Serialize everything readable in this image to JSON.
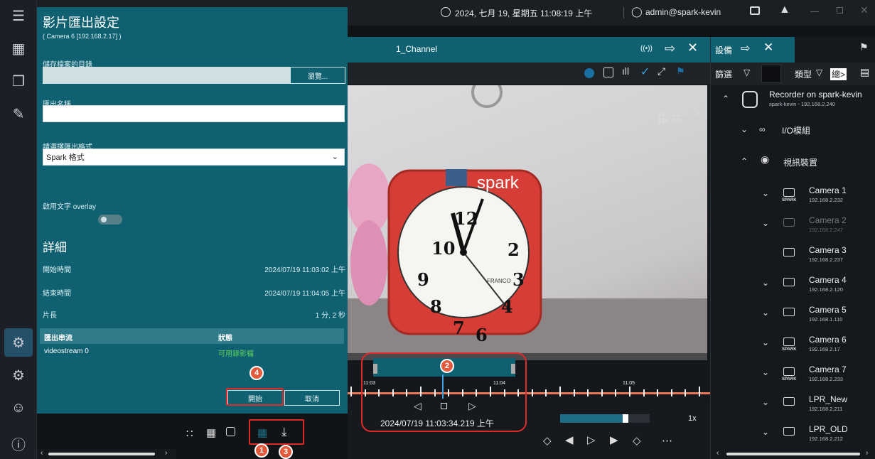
{
  "topbar": {
    "datetime": "2024, 七月 19, 星期五 11:08:19 上午",
    "user": "admin@spark-kevin"
  },
  "dialog": {
    "title": "影片匯出設定",
    "subtitle": "( Camera 6 [192.168.2.17] )",
    "folder_label": "儲存檔案的目錄",
    "browse_label": "瀏覽...",
    "name_label": "匯出名稱",
    "format_label": "請選擇匯出格式",
    "format_value": "Spark 格式",
    "overlay_label": "啟用文字 overlay",
    "details_heading": "詳細",
    "start_label": "開始時間",
    "start_value": "2024/07/19 11:03:02 上午",
    "end_label": "結束時間",
    "end_value": "2024/07/19 11:04:05 上午",
    "length_label": "片長",
    "length_value": "1 分, 2 秒",
    "table_headers": [
      "匯出串流",
      "狀態"
    ],
    "table_rows": [
      {
        "stream": "videostream 0",
        "status": "可用錄影檔"
      }
    ],
    "start_button": "開始",
    "cancel_button": "取消"
  },
  "video": {
    "channel_title": "1_Channel",
    "overlay_text_line1": "01. 21. 1. 8. 250",
    "overlay_text_line2": "51 _BM2",
    "brand_text": "spark",
    "clock_brand": "FRANCO",
    "timeline_ticks": [
      "11:03",
      "11:04",
      "11:05"
    ],
    "timestamp": "2024/07/19 11:03:34.219 上午",
    "speed": "1x",
    "progress": 0.75
  },
  "markers": [
    "1",
    "2",
    "3",
    "4"
  ],
  "rightpanel": {
    "title": "設備",
    "filter_label": "篩選",
    "type_label": "類型",
    "total_label": "總>",
    "recorder_name": "Recorder on spark-kevin",
    "recorder_sub": "spark-kevin - 192.168.2.240",
    "io_module": "I/O模組",
    "video_devices": "視訊裝置",
    "brand_small": "SPARK",
    "cameras": [
      {
        "name": "Camera 1",
        "ip": "192.168.2.232"
      },
      {
        "name": "Camera 2",
        "ip": "192.168.2.247"
      },
      {
        "name": "Camera 3",
        "ip": "192.168.2.237"
      },
      {
        "name": "Camera 4",
        "ip": "192.168.2.120"
      },
      {
        "name": "Camera 5",
        "ip": "192.168.1.110"
      },
      {
        "name": "Camera 6",
        "ip": "192.168.2.17"
      },
      {
        "name": "Camera 7",
        "ip": "192.168.2.233"
      },
      {
        "name": "LPR_New",
        "ip": "192.168.2.211"
      },
      {
        "name": "LPR_OLD",
        "ip": "192.168.2.212"
      }
    ]
  },
  "colors": {
    "dialog_bg": "#0f6171",
    "accent_red": "#e02a2a",
    "marker": "#e25a3b",
    "status_green": "#5ed35a",
    "timeline_orange": "#e8785c"
  }
}
